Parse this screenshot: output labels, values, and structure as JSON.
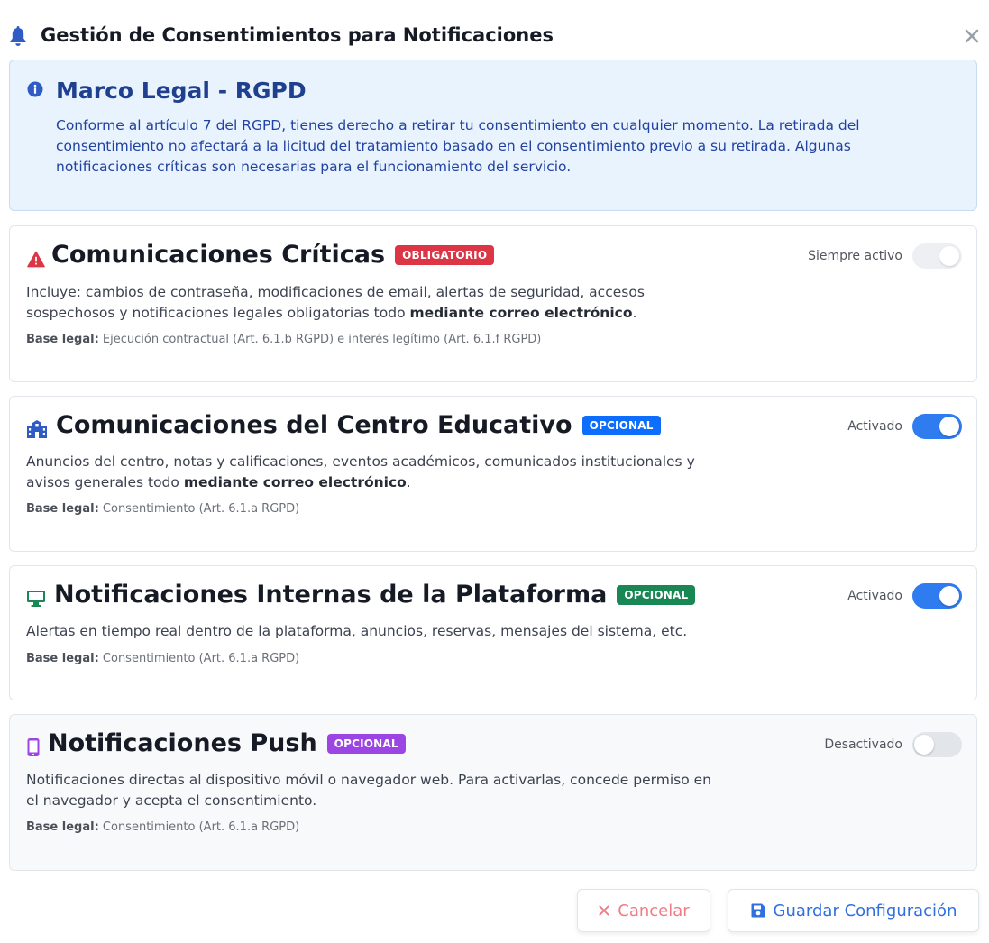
{
  "header": {
    "title": "Gestión de Consentimientos para Notificaciones"
  },
  "legal": {
    "title": "Marco Legal - RGPD",
    "text": "Conforme al artículo 7 del RGPD, tienes derecho a retirar tu consentimiento en cualquier momento. La retirada del consentimiento no afectará a la licitud del tratamiento basado en el consentimiento previo a su retirada. Algunas notificaciones críticas son necesarias para el funcionamiento del servicio."
  },
  "cards": [
    {
      "title": "Comunicaciones Críticas",
      "icon": "warning-icon",
      "badge": "OBLIGATORIO",
      "badge_color": "#dc3545",
      "status": "Siempre activo",
      "enabled": true,
      "locked": true,
      "desc_text": "Incluye: cambios de contraseña, modificaciones de email, alertas de seguridad, accesos sospechosos y notificaciones legales obligatorias todo ",
      "desc_bold": "mediante correo electrónico",
      "desc_end": ".",
      "basis_label": "Base legal:",
      "basis_text": " Ejecución contractual (Art. 6.1.b RGPD) e interés legítimo (Art. 6.1.f RGPD)"
    },
    {
      "title": "Comunicaciones del Centro Educativo",
      "icon": "school-icon",
      "badge": "OPCIONAL",
      "badge_color": "#0d6efd",
      "status": "Activado",
      "enabled": true,
      "locked": false,
      "desc_text": "Anuncios del centro, notas y calificaciones, eventos académicos, comunicados institucionales y avisos generales todo ",
      "desc_bold": "mediante correo electrónico",
      "desc_end": ".",
      "basis_label": "Base legal:",
      "basis_text": " Consentimiento (Art. 6.1.a RGPD)"
    },
    {
      "title": "Notificaciones Internas de la Plataforma",
      "icon": "desktop-icon",
      "badge": "OPCIONAL",
      "badge_color": "#198754",
      "status": "Activado",
      "enabled": true,
      "locked": false,
      "desc_text": "Alertas en tiempo real dentro de la plataforma, anuncios, reservas, mensajes del sistema, etc.",
      "desc_bold": "",
      "desc_end": "",
      "basis_label": "Base legal:",
      "basis_text": " Consentimiento (Art. 6.1.a RGPD)"
    },
    {
      "title": "Notificaciones Push",
      "icon": "mobile-icon",
      "badge": "OPCIONAL",
      "badge_color": "#9b45e4",
      "status": "Desactivado",
      "enabled": false,
      "locked": false,
      "desc_text": "Notificaciones directas al dispositivo móvil o navegador web. Para activarlas, concede permiso en el navegador y acepta el consentimiento.",
      "desc_bold": "",
      "desc_end": "",
      "basis_label": "Base legal:",
      "basis_text": " Consentimiento (Art. 6.1.a RGPD)"
    }
  ],
  "footer": {
    "cancel_label": "Cancelar",
    "save_label": "Guardar Configuración"
  },
  "colors": {
    "accent": "#2f7bf0",
    "info_bg": "#e9f3fe",
    "info_text": "#2142a0",
    "cancel": "#f07d86"
  }
}
